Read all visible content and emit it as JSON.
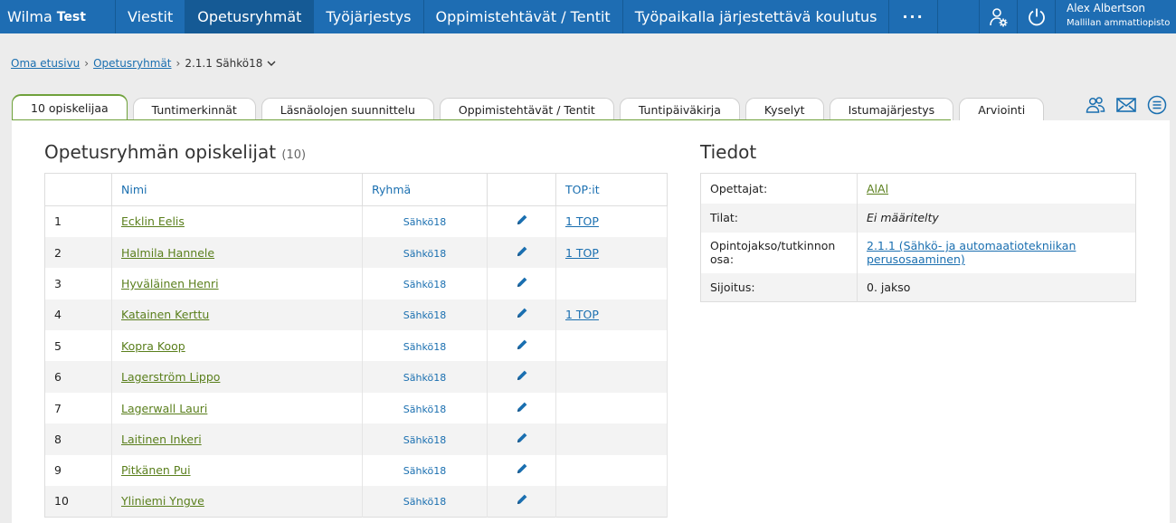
{
  "brand": {
    "name": "Wilma",
    "env": "Test"
  },
  "nav": {
    "items": [
      {
        "label": "Viestit",
        "active": false
      },
      {
        "label": "Opetusryhmät",
        "active": true
      },
      {
        "label": "Työjärjestys",
        "active": false
      },
      {
        "label": "Oppimistehtävät / Tentit",
        "active": false
      },
      {
        "label": "Työpaikalla järjestettävä koulutus",
        "active": false
      }
    ],
    "more_label": "···",
    "user_name": "Alex Albertson",
    "school": "Mallilan ammattiopisto"
  },
  "breadcrumb": {
    "home": "Oma etusivu",
    "groups": "Opetusryhmät",
    "current": "2.1.1 Sähkö18",
    "separator": "›"
  },
  "tabs": [
    "10 opiskelijaa",
    "Tuntimerkinnät",
    "Läsnäolojen suunnittelu",
    "Oppimistehtävät / Tentit",
    "Tuntipäiväkirja",
    "Kyselyt",
    "Istumajärjestys",
    "Arviointi"
  ],
  "students_section": {
    "title": "Opetusryhmän opiskelijat",
    "count": "(10)",
    "headers": {
      "num": "",
      "name": "Nimi",
      "group": "Ryhmä",
      "edit": "",
      "top": "TOP:it"
    },
    "rows": [
      {
        "num": "1",
        "name": "Ecklin Eelis",
        "group": "Sähkö18",
        "top": "1 TOP"
      },
      {
        "num": "2",
        "name": "Halmila Hannele",
        "group": "Sähkö18",
        "top": "1 TOP"
      },
      {
        "num": "3",
        "name": "Hyväläinen Henri",
        "group": "Sähkö18",
        "top": ""
      },
      {
        "num": "4",
        "name": "Katainen Kerttu",
        "group": "Sähkö18",
        "top": "1 TOP"
      },
      {
        "num": "5",
        "name": "Kopra Koop",
        "group": "Sähkö18",
        "top": ""
      },
      {
        "num": "6",
        "name": "Lagerström Lippo",
        "group": "Sähkö18",
        "top": ""
      },
      {
        "num": "7",
        "name": "Lagerwall Lauri",
        "group": "Sähkö18",
        "top": ""
      },
      {
        "num": "8",
        "name": "Laitinen Inkeri",
        "group": "Sähkö18",
        "top": ""
      },
      {
        "num": "9",
        "name": "Pitkänen Pui",
        "group": "Sähkö18",
        "top": ""
      },
      {
        "num": "10",
        "name": "Yliniemi Yngve",
        "group": "Sähkö18",
        "top": ""
      }
    ]
  },
  "info_section": {
    "title": "Tiedot",
    "rows": [
      {
        "key": "Opettajat:",
        "value": "AlAl",
        "kind": "link-green"
      },
      {
        "key": "Tilat:",
        "value": "Ei määritelty",
        "kind": "italic"
      },
      {
        "key": "Opintojakso/tutkinnon osa:",
        "value": "2.1.1 (Sähkö- ja automaatiotekniikan perusosaaminen)",
        "kind": "link-blue"
      },
      {
        "key": "Sijoitus:",
        "value": "0. jakso",
        "kind": "text"
      }
    ]
  },
  "colors": {
    "nav": "#1e6db3",
    "nav_active": "#155a95",
    "accent_green": "#6fa13b",
    "link": "#1a6fb0",
    "name_link": "#5a7f1c"
  },
  "icons": [
    "user-settings-icon",
    "power-icon",
    "chevron-down-icon",
    "pencil-icon",
    "group-icon",
    "mail-icon",
    "list-menu-icon"
  ]
}
